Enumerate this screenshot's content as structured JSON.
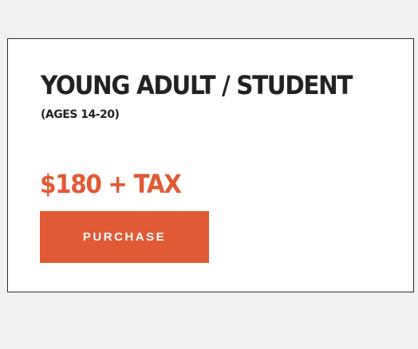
{
  "card": {
    "title": "YOUNG ADULT / STUDENT",
    "subtitle": "(AGES 14-20)",
    "price": "$180 + TAX",
    "purchase_label": "PURCHASE"
  },
  "colors": {
    "accent": "#e05a35",
    "text": "#222222",
    "background": "#f1f1f1",
    "card_background": "#ffffff"
  }
}
